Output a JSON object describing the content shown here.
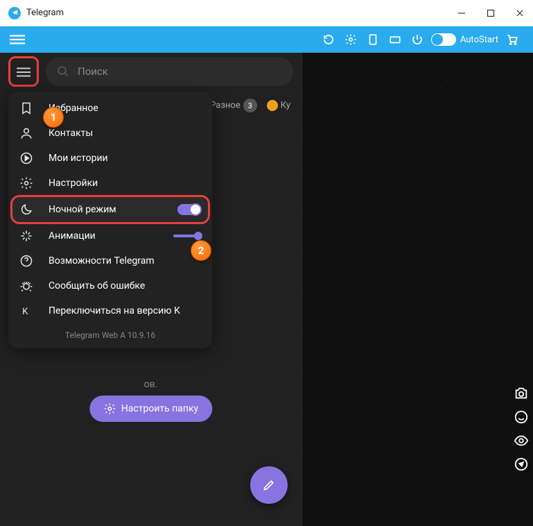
{
  "window": {
    "title": "Telegram"
  },
  "toolbar": {
    "autostart_label": "AutoStart"
  },
  "search": {
    "placeholder": "Поиск"
  },
  "folders": {
    "item1": "Разное",
    "badge1": "3",
    "item2": "Ку"
  },
  "menu": {
    "saved": "Избранное",
    "contacts": "Контакты",
    "stories": "Мои истории",
    "settings": "Настройки",
    "night": "Ночной режим",
    "animations": "Анимации",
    "premium": "Возможности Telegram",
    "bug": "Сообщить об ошибке",
    "switchk": "Переключиться на версию K",
    "version": "Telegram Web A 10.9.16"
  },
  "empty": {
    "hint": "ов."
  },
  "setup_button": "Настроить папку",
  "markers": {
    "one": "1",
    "two": "2"
  }
}
